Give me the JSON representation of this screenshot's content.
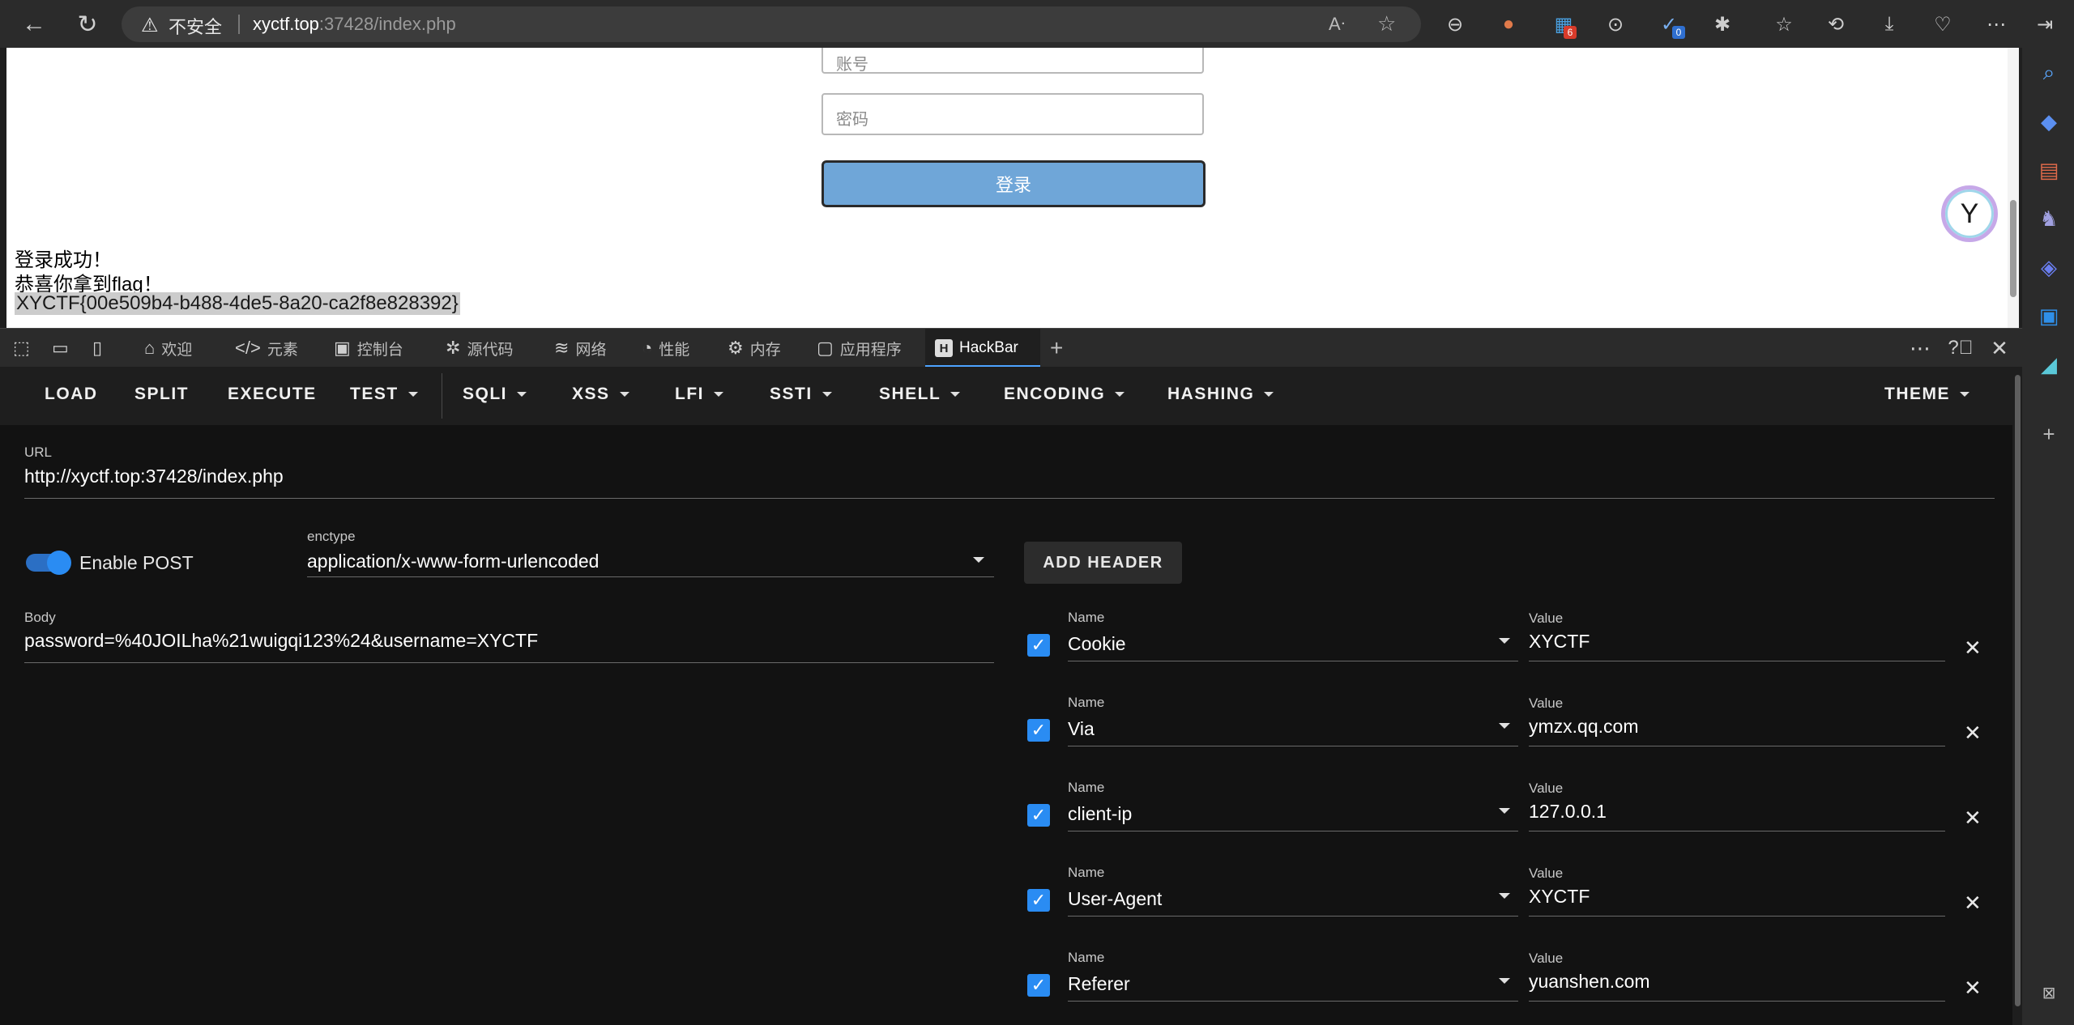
{
  "browser": {
    "security_label": "不安全",
    "url_host": "xyctf.top",
    "url_rest": ":37428/index.php",
    "extension_badges": [
      "6",
      "0"
    ]
  },
  "page": {
    "username_placeholder": "账号",
    "password_placeholder": "密码",
    "login_label": "登录",
    "success_line": "登录成功！",
    "flag_line": "恭喜你拿到flag！",
    "flag": "XYCTF{00e509b4-b488-4de5-8a20-ca2f8e828392}"
  },
  "devtools": {
    "tabs": [
      {
        "label": "欢迎",
        "icon": "⌂"
      },
      {
        "label": "元素",
        "icon": "</>"
      },
      {
        "label": "控制台",
        "icon": "▣"
      },
      {
        "label": "源代码",
        "icon": "⚙"
      },
      {
        "label": "网络",
        "icon": "≋"
      },
      {
        "label": "性能",
        "icon": "◔"
      },
      {
        "label": "内存",
        "icon": "⚙"
      },
      {
        "label": "应用程序",
        "icon": "▢"
      },
      {
        "label": "HackBar",
        "icon": "H"
      }
    ]
  },
  "hackbar": {
    "menu": {
      "load": "LOAD",
      "split": "SPLIT",
      "execute": "EXECUTE",
      "test": "TEST",
      "sqli": "SQLI",
      "xss": "XSS",
      "lfi": "LFI",
      "ssti": "SSTI",
      "shell": "SHELL",
      "encoding": "ENCODING",
      "hashing": "HASHING",
      "theme": "THEME"
    },
    "url_label": "URL",
    "url_value": "http://xyctf.top:37428/index.php",
    "enable_post_label": "Enable POST",
    "enctype_label": "enctype",
    "enctype_value": "application/x-www-form-urlencoded",
    "add_header_label": "ADD HEADER",
    "body_label": "Body",
    "body_value": "password=%40JOILha%21wuigqi123%24&username=XYCTF",
    "header_name_label": "Name",
    "header_value_label": "Value",
    "headers": [
      {
        "name": "Cookie",
        "value": "XYCTF"
      },
      {
        "name": "Via",
        "value": "ymzx.qq.com"
      },
      {
        "name": "client-ip",
        "value": "127.0.0.1"
      },
      {
        "name": "User-Agent",
        "value": "XYCTF"
      },
      {
        "name": "Referer",
        "value": "yuanshen.com"
      }
    ]
  }
}
